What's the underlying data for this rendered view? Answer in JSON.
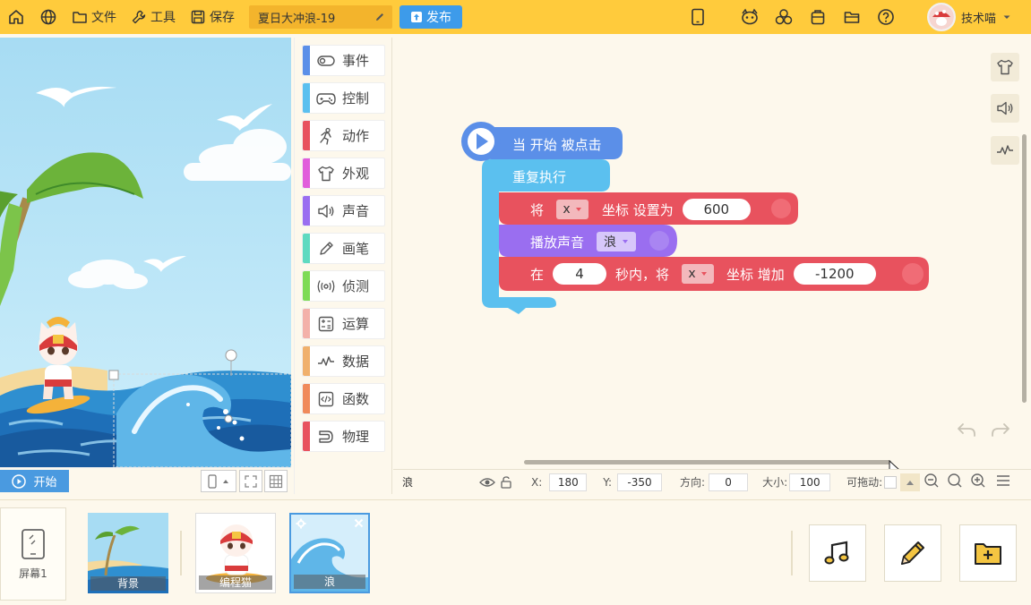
{
  "topbar": {
    "file_label": "文件",
    "tools_label": "工具",
    "save_label": "保存",
    "project_title": "夏日大冲浪-19",
    "publish_label": "发布",
    "user_name": "技术喵"
  },
  "stage": {
    "start_label": "开始"
  },
  "categories": [
    {
      "label": "事件",
      "color": "#5b8fe8",
      "icon": "toggle-icon"
    },
    {
      "label": "控制",
      "color": "#5bc0ef",
      "icon": "gamepad-icon"
    },
    {
      "label": "动作",
      "color": "#e8525e",
      "icon": "running-icon"
    },
    {
      "label": "外观",
      "color": "#e15ddb",
      "icon": "shirt-icon"
    },
    {
      "label": "声音",
      "color": "#9a6ef0",
      "icon": "speaker-icon"
    },
    {
      "label": "画笔",
      "color": "#5fdac0",
      "icon": "pen-icon"
    },
    {
      "label": "侦测",
      "color": "#7edb55",
      "icon": "radar-icon"
    },
    {
      "label": "运算",
      "color": "#f3b1a9",
      "icon": "calculator-icon"
    },
    {
      "label": "数据",
      "color": "#f0b06c",
      "icon": "data-icon"
    },
    {
      "label": "函数",
      "color": "#f08a5a",
      "icon": "code-icon"
    },
    {
      "label": "物理",
      "color": "#e8525e",
      "icon": "magnet-icon"
    }
  ],
  "blocks": {
    "hat_label": "当 开始 被点击",
    "repeat_label": "重复执行",
    "set_pre": "将",
    "set_axis": "x",
    "set_mid": "坐标 设置为",
    "set_value": "600",
    "sound_label": "播放声音",
    "sound_name": "浪",
    "glide_pre": "在",
    "glide_secs": "4",
    "glide_mid": "秒内，将",
    "glide_axis": "x",
    "glide_post": "坐标 增加",
    "glide_value": "-1200"
  },
  "props": {
    "sprite_name": "浪",
    "x_label": "X:",
    "x_value": "180",
    "y_label": "Y:",
    "y_value": "-350",
    "dir_label": "方向:",
    "dir_value": "0",
    "size_label": "大小:",
    "size_value": "100",
    "drag_label": "可拖动:"
  },
  "sprites": {
    "screen_label": "屏幕1",
    "items": [
      {
        "label": "背景"
      },
      {
        "label": "编程猫"
      },
      {
        "label": "浪"
      }
    ]
  },
  "colors": {
    "topbar": "#ffcb3c",
    "event_block": "#5b8fe8",
    "control_block": "#5bc0ef",
    "motion_block": "#e8525e",
    "sound_block": "#9a6ef0",
    "publish": "#3d9bea"
  }
}
